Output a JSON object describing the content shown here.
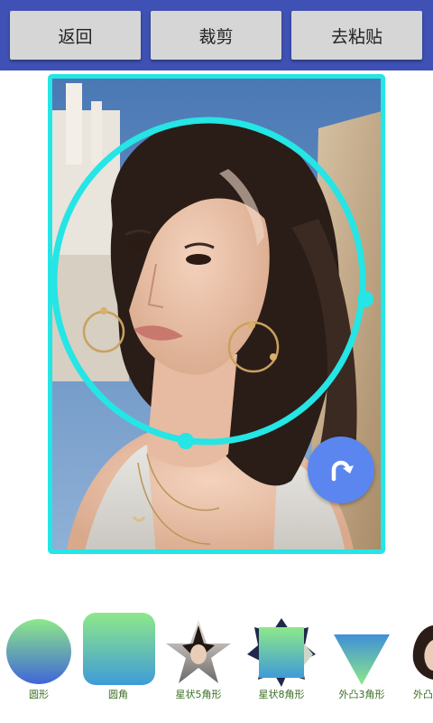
{
  "toolbar": {
    "back_label": "返回",
    "crop_label": "裁剪",
    "paste_label": "去粘贴"
  },
  "editor": {
    "crop_shape": "ellipse",
    "accent_color": "#25e5e5",
    "rotate_icon": "rotate-clockwise-icon"
  },
  "shapes": [
    {
      "label": "圆形",
      "icon": "circle-gradient-icon"
    },
    {
      "label": "圆角",
      "icon": "rounded-square-gradient-icon"
    },
    {
      "label": "星状5角形",
      "icon": "five-point-star-icon"
    },
    {
      "label": "星状8角形",
      "icon": "eight-point-star-icon"
    },
    {
      "label": "外凸3角形",
      "icon": "convex-triangle-icon"
    },
    {
      "label": "外凸",
      "icon": "convex-shape-icon"
    }
  ],
  "colors": {
    "topbar": "#3f51b5",
    "button_bg": "#d6d6d6",
    "rotate_button": "#5b86f0",
    "shape_label": "#3a6e22"
  }
}
